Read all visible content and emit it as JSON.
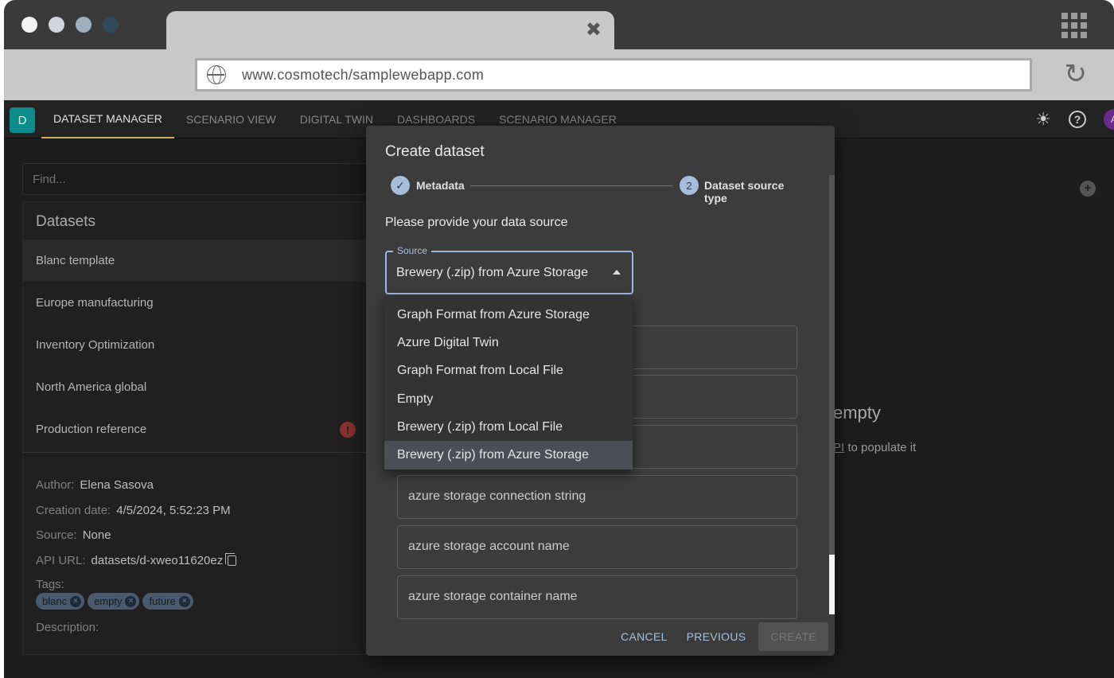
{
  "browser": {
    "url": "www.cosmotech/samplewebapp.com",
    "dot_colors": [
      "#f2f2f2",
      "#cfd6dd",
      "#9fadbc",
      "#2f4a58"
    ]
  },
  "app": {
    "logo_letter": "D",
    "nav": [
      "DATASET MANAGER",
      "SCENARIO VIEW",
      "DIGITAL TWIN",
      "DASHBOARDS",
      "SCENARIO MANAGER"
    ],
    "avatar_letter": "A",
    "accent_color": "#c9b15a"
  },
  "sidebar": {
    "find_placeholder": "Find...",
    "title": "Datasets",
    "items": [
      "Blanc template",
      "Europe manufacturing",
      "Inventory Optimization",
      "North America global",
      "Production reference"
    ],
    "selected_index": 0,
    "warning_item_index": 4
  },
  "details": {
    "author_label": "Author:",
    "author": "Elena Sasova",
    "creation_label": "Creation date:",
    "creation_date": "4/5/2024, 5:52:23 PM",
    "source_label": "Source:",
    "source": "None",
    "api_label": "API URL:",
    "api_url": "datasets/d-xweo11620ez",
    "tags_label": "Tags:",
    "tags": [
      "blanc",
      "empty",
      "future"
    ],
    "description_label": "Description:"
  },
  "main_empty": {
    "title_fragment": "empty",
    "sub_link": "PI",
    "sub_text": " to populate it"
  },
  "dialog": {
    "title": "Create dataset",
    "steps": [
      {
        "label": "Metadata",
        "state": "completed"
      },
      {
        "number": "2",
        "label": "Dataset source type",
        "state": "active"
      }
    ],
    "prompt": "Please provide your data source",
    "source": {
      "legend": "Source",
      "value": "Brewery (.zip) from Azure Storage"
    },
    "options": [
      "Graph Format from Azure Storage",
      "Azure Digital Twin",
      "Graph Format from Local File",
      "Empty",
      "Brewery (.zip) from Local File",
      "Brewery (.zip) from Azure Storage"
    ],
    "selected_option_index": 5,
    "fields": [
      {
        "placeholder": ""
      },
      {
        "placeholder": ""
      },
      {
        "placeholder": ""
      },
      {
        "placeholder": "azure storage connection string"
      },
      {
        "placeholder": "azure storage account name"
      },
      {
        "placeholder": "azure storage container name"
      }
    ],
    "actions": {
      "cancel": "CANCEL",
      "previous": "PREVIOUS",
      "create": "CREATE"
    }
  }
}
